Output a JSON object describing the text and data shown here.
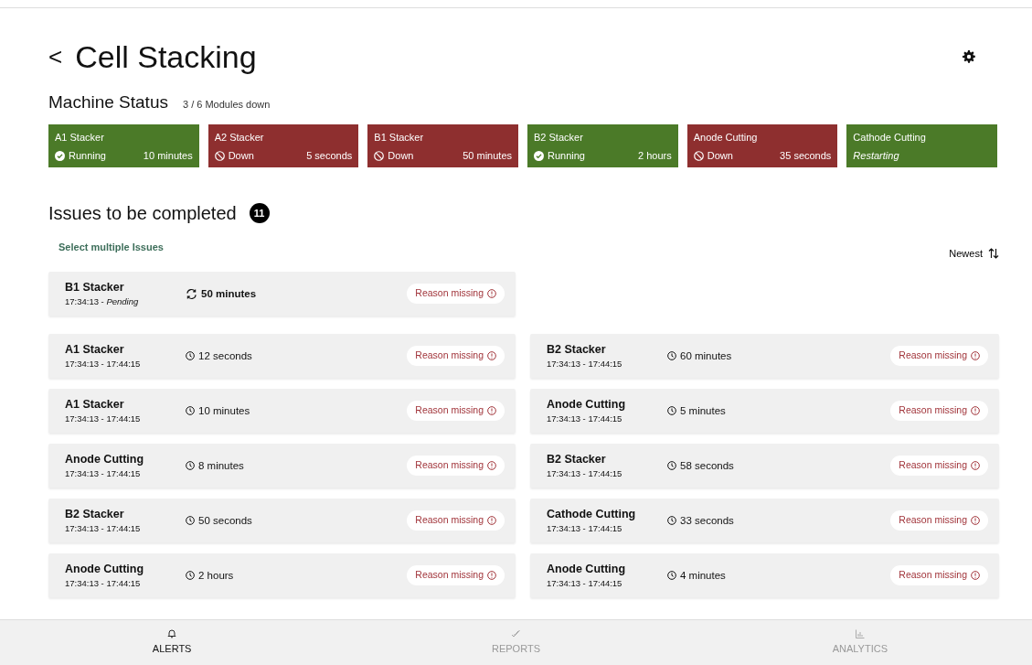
{
  "header": {
    "back": "<",
    "title": "Cell Stacking"
  },
  "machine_status": {
    "title": "Machine Status",
    "summary": "3 / 6 Modules down",
    "modules": [
      {
        "name": "A1 Stacker",
        "kind": "running",
        "label": "Running",
        "duration": "10 minutes"
      },
      {
        "name": "A2 Stacker",
        "kind": "down",
        "label": "Down",
        "duration": "5 seconds"
      },
      {
        "name": "B1 Stacker",
        "kind": "down",
        "label": "Down",
        "duration": "50 minutes"
      },
      {
        "name": "B2 Stacker",
        "kind": "running",
        "label": "Running",
        "duration": "2 hours"
      },
      {
        "name": "Anode Cutting",
        "kind": "down",
        "label": "Down",
        "duration": "35 seconds"
      },
      {
        "name": "Cathode Cutting",
        "kind": "restarting",
        "label": "Restarting"
      }
    ]
  },
  "issues": {
    "title": "Issues to be completed",
    "count": "11",
    "select_link": "Select multiple Issues",
    "sort": "Newest",
    "pending": {
      "name": "B1 Stacker",
      "time": "17:34:13 - ",
      "state": "Pending",
      "duration": "50 minutes",
      "reason": "Reason missing"
    },
    "items": [
      {
        "name": "A1 Stacker",
        "time": "17:34:13 - 17:44:15",
        "duration": "12 seconds",
        "reason": "Reason missing"
      },
      {
        "name": "B2 Stacker",
        "time": "17:34:13 - 17:44:15",
        "duration": "60 minutes",
        "reason": "Reason missing"
      },
      {
        "name": "A1 Stacker",
        "time": "17:34:13 - 17:44:15",
        "duration": "10 minutes",
        "reason": "Reason missing"
      },
      {
        "name": "Anode Cutting",
        "time": "17:34:13 - 17:44:15",
        "duration": "5 minutes",
        "reason": "Reason missing"
      },
      {
        "name": "Anode Cutting",
        "time": "17:34:13 - 17:44:15",
        "duration": "8 minutes",
        "reason": "Reason missing"
      },
      {
        "name": "B2 Stacker",
        "time": "17:34:13 - 17:44:15",
        "duration": "58 seconds",
        "reason": "Reason missing"
      },
      {
        "name": "B2 Stacker",
        "time": "17:34:13 - 17:44:15",
        "duration": "50 seconds",
        "reason": "Reason missing"
      },
      {
        "name": "Cathode Cutting",
        "time": "17:34:13 - 17:44:15",
        "duration": "33 seconds",
        "reason": "Reason missing"
      },
      {
        "name": "Anode Cutting",
        "time": "17:34:13 - 17:44:15",
        "duration": "2 hours",
        "reason": "Reason missing"
      },
      {
        "name": "Anode Cutting",
        "time": "17:34:13 - 17:44:15",
        "duration": "4 minutes",
        "reason": "Reason missing"
      }
    ]
  },
  "nav": [
    {
      "label": "ALERTS",
      "selected": true
    },
    {
      "label": "REPORTS",
      "selected": false
    },
    {
      "label": "ANALYTICS",
      "selected": false
    }
  ]
}
